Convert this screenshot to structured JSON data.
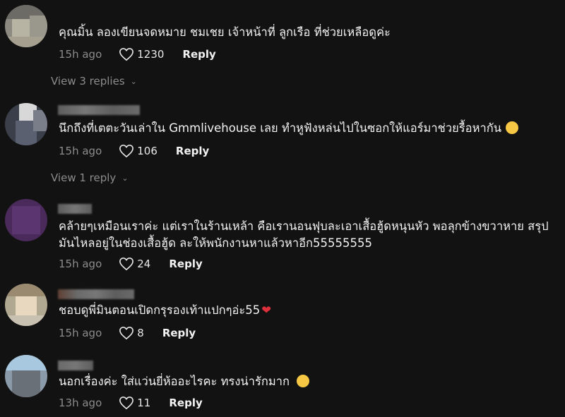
{
  "comments": [
    {
      "text": "คุณมิ้น ลองเขียนจดหมาย ชมเชย เจ้าหน้าที่ ลูกเรือ ที่ช่วยเหลือดูค่ะ",
      "time": "15h ago",
      "likes": "1230",
      "reply_label": "Reply",
      "view_replies": "View 3 replies"
    },
    {
      "text": "นึกถึงที่เตตะวันเล่าใน Gmmlivehouse เลย ทำหูฟังหล่นไปในซอกให้แอร์มาช่วยรื้อหากัน",
      "emoji": "laughing-tears-emoji",
      "time": "15h ago",
      "likes": "106",
      "reply_label": "Reply",
      "view_replies": "View 1 reply"
    },
    {
      "text": "คล้ายๆเหมือนเราค่ะ แต่เราในร้านเหล้า คือเรานอนฟุบละเอาเสื้อฮู้ดหนุนหัว พอลุกข้างขวาหาย สรุป\nมันไหลอยู่ในช่องเสื้อฮู้ด ละให้พนักงานหาแล้วหาอีก55555555",
      "time": "15h ago",
      "likes": "24",
      "reply_label": "Reply"
    },
    {
      "text": "ชอบดูพี่มินตอนเปิดกรุรองเท้าแปกๆอ่ะ55",
      "emoji": "red-heart-emoji",
      "time": "15h ago",
      "likes": "8",
      "reply_label": "Reply"
    },
    {
      "text": "นอกเรื่องค่ะ ใส่แว่นยี่ห้ออะไรคะ ทรงน่ารักมาก",
      "emoji": "smiling-emoji",
      "time": "13h ago",
      "likes": "11",
      "reply_label": "Reply"
    }
  ],
  "colors": {
    "background": "#121212",
    "text": "#f2f2f2",
    "muted": "#8c8c8c",
    "heart": "#e0303d"
  }
}
